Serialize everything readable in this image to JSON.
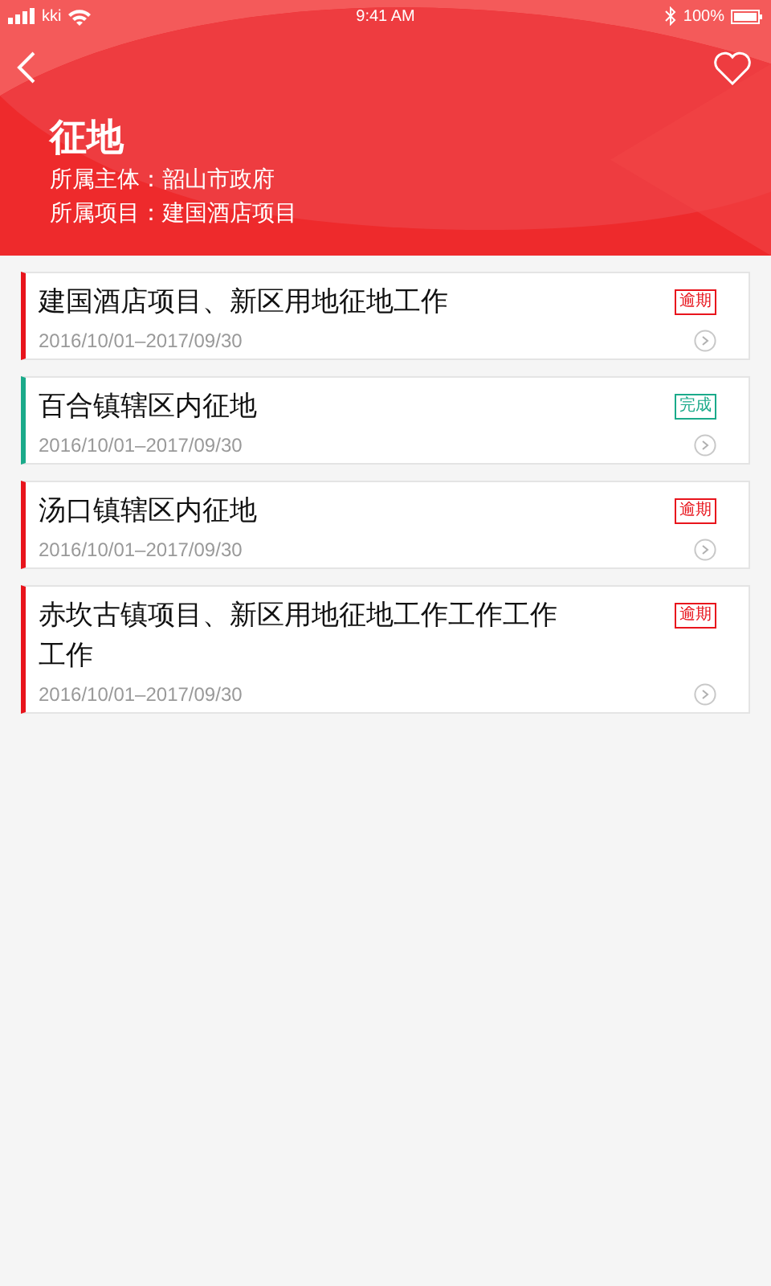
{
  "status_bar": {
    "carrier": "kki",
    "time": "9:41 AM",
    "battery": "100%"
  },
  "header": {
    "title": "征地",
    "fields": [
      {
        "label": "所属主体：",
        "value": "韶山市政府"
      },
      {
        "label": "所属项目：",
        "value": "建国酒店项目"
      }
    ]
  },
  "tasks": [
    {
      "title": "建国酒店项目、新区用地征地工作",
      "dates": "2016/10/01–2017/09/30",
      "status": "逾期",
      "color": "#e8141c"
    },
    {
      "title": "百合镇辖区内征地",
      "dates": "2016/10/01–2017/09/30",
      "status": "完成",
      "color": "#1aaa8a"
    },
    {
      "title": "汤口镇辖区内征地",
      "dates": "2016/10/01–2017/09/30",
      "status": "逾期",
      "color": "#e8141c"
    },
    {
      "title": "赤坎古镇项目、新区用地征地工作工作工作工作",
      "dates": "2016/10/01–2017/09/30",
      "status": "逾期",
      "color": "#e8141c"
    }
  ]
}
